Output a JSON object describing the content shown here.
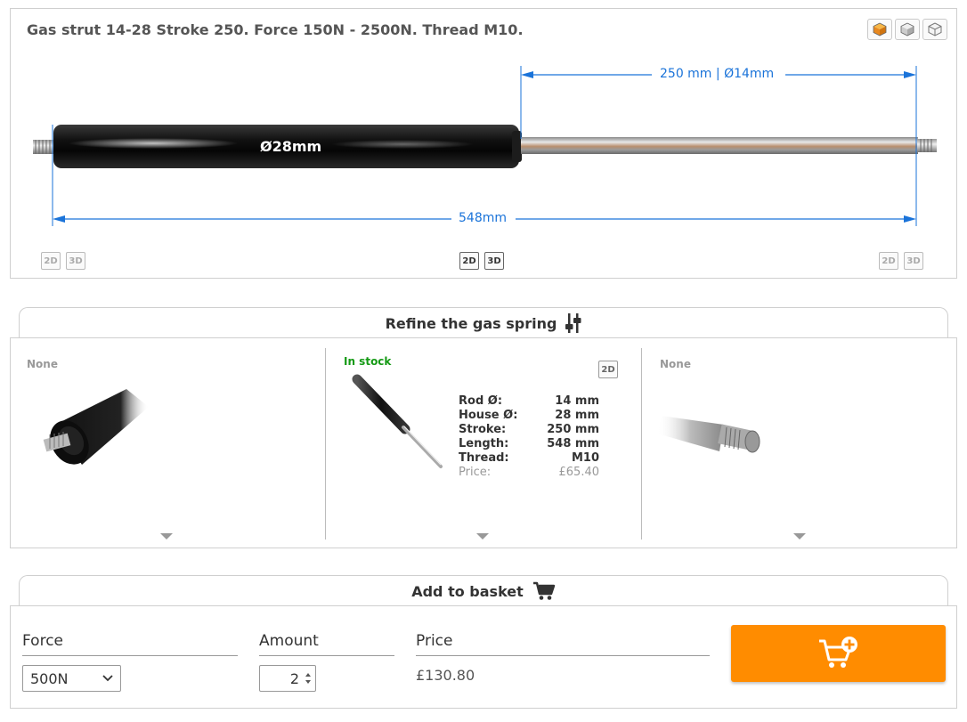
{
  "product": {
    "title": "Gas strut 14-28 Stroke 250. Force 150N - 2500N. Thread M10.",
    "dim_stroke": "250 mm | Ø14mm",
    "dim_length": "548mm",
    "dim_body": "Ø28mm"
  },
  "view_badges": {
    "two_d": "2D",
    "three_d": "3D"
  },
  "refine": {
    "heading": "Refine the gas spring",
    "left": {
      "status": "None"
    },
    "center": {
      "status": "In stock",
      "badge": "2D",
      "specs": [
        {
          "key": "Rod Ø:",
          "value": "14 mm"
        },
        {
          "key": "House Ø:",
          "value": "28 mm"
        },
        {
          "key": "Stroke:",
          "value": "250 mm"
        },
        {
          "key": "Length:",
          "value": "548 mm"
        },
        {
          "key": "Thread:",
          "value": "M10"
        }
      ],
      "price_label": "Price:",
      "price_value": "£65.40"
    },
    "right": {
      "status": "None"
    }
  },
  "basket": {
    "heading": "Add to basket",
    "force_label": "Force",
    "force_value": "500N",
    "amount_label": "Amount",
    "amount_value": "2",
    "price_label": "Price",
    "price_value": "£130.80"
  },
  "colors": {
    "accent": "#ff8c00",
    "dimension": "#1a73d9",
    "in_stock": "#159a15"
  }
}
